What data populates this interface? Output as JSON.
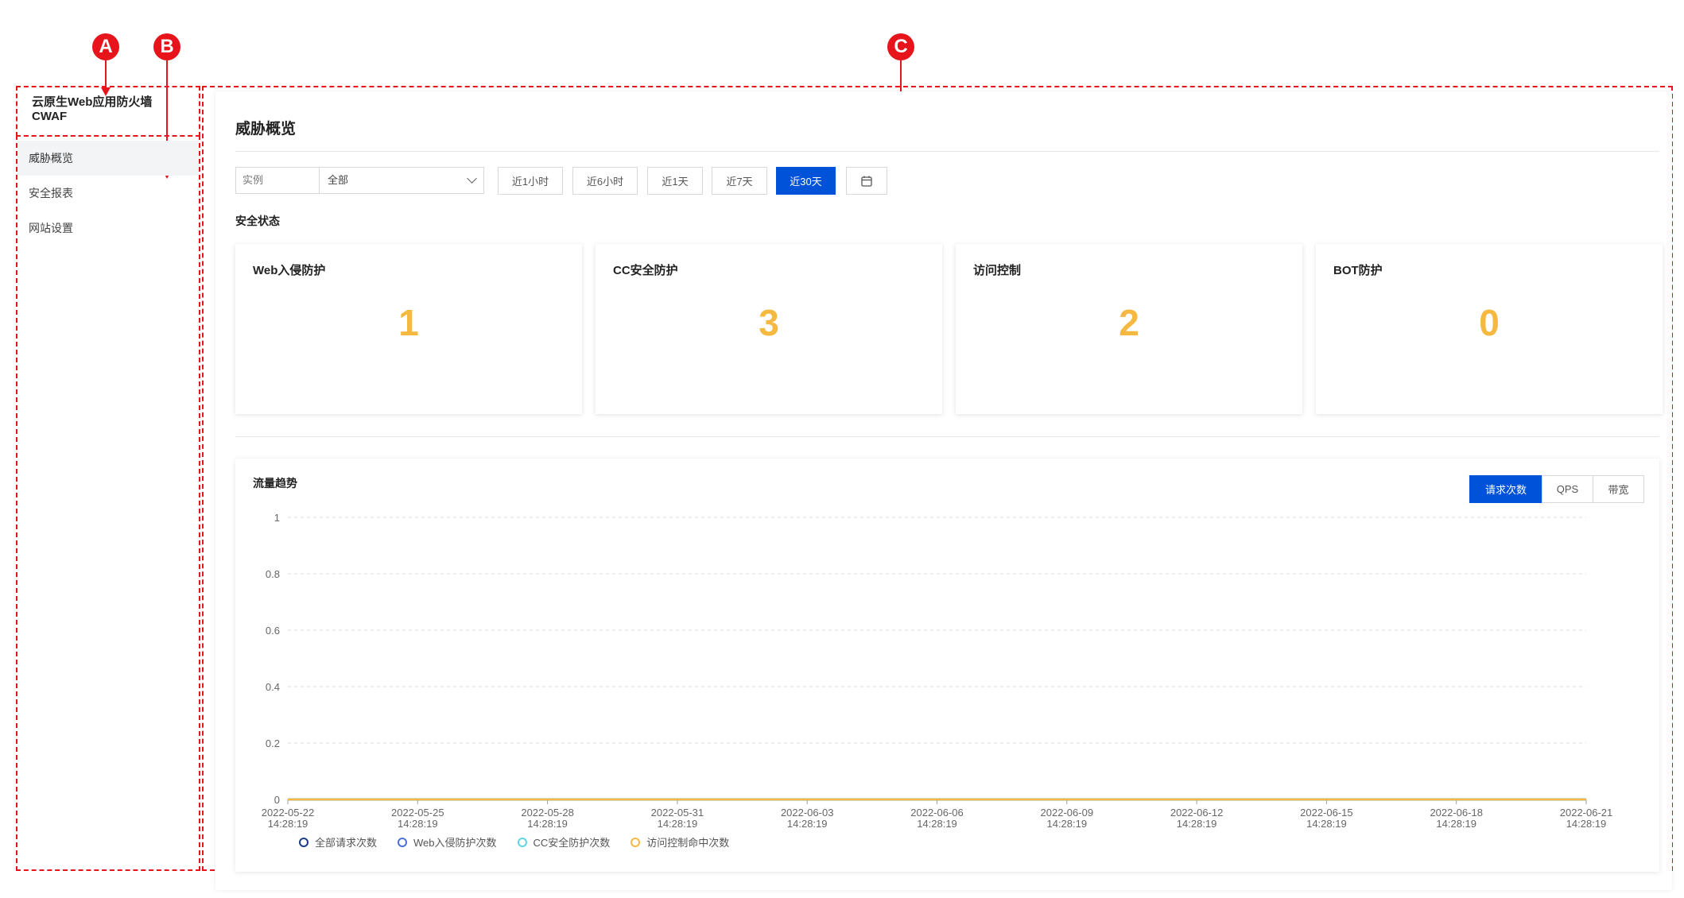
{
  "callouts": [
    "A",
    "B",
    "C"
  ],
  "sidebar": {
    "brand_line1": "云原生Web应用防火墙",
    "brand_line2": "CWAF",
    "items": [
      {
        "label": "威胁概览",
        "active": true
      },
      {
        "label": "安全报表",
        "active": false
      },
      {
        "label": "网站设置",
        "active": false
      }
    ]
  },
  "main": {
    "title": "威胁概览",
    "filter": {
      "instance_label": "实例",
      "instance_value": "全部",
      "time_buttons": [
        "近1小时",
        "近6小时",
        "近1天",
        "近7天",
        "近30天"
      ],
      "active_time": "近30天",
      "calendar_icon": "calendar-icon"
    },
    "security_status": {
      "title": "安全状态",
      "cards": [
        {
          "label": "Web入侵防护",
          "value": "1"
        },
        {
          "label": "CC安全防护",
          "value": "3"
        },
        {
          "label": "访问控制",
          "value": "2"
        },
        {
          "label": "BOT防护",
          "value": "0"
        }
      ],
      "value_color": "#f5b841"
    },
    "traffic": {
      "title": "流量趋势",
      "metric_tabs": [
        "请求次数",
        "QPS",
        "带宽"
      ],
      "active_metric": "请求次数"
    }
  },
  "accent_color": "#0052d9",
  "chart_data": {
    "type": "line",
    "title": "流量趋势",
    "ylim": [
      0,
      1
    ],
    "yticks": [
      "1",
      "0.8",
      "0.6",
      "0.4",
      "0.2",
      "0"
    ],
    "x_ticks": [
      {
        "date": "2022-05-22",
        "time": "14:28:19"
      },
      {
        "date": "2022-05-25",
        "time": "14:28:19"
      },
      {
        "date": "2022-05-28",
        "time": "14:28:19"
      },
      {
        "date": "2022-05-31",
        "time": "14:28:19"
      },
      {
        "date": "2022-06-03",
        "time": "14:28:19"
      },
      {
        "date": "2022-06-06",
        "time": "14:28:19"
      },
      {
        "date": "2022-06-09",
        "time": "14:28:19"
      },
      {
        "date": "2022-06-12",
        "time": "14:28:19"
      },
      {
        "date": "2022-06-15",
        "time": "14:28:19"
      },
      {
        "date": "2022-06-18",
        "time": "14:28:19"
      },
      {
        "date": "2022-06-21",
        "time": "14:28:19"
      }
    ],
    "series": [
      {
        "name": "全部请求次数",
        "color": "#1f3a8a",
        "values": [
          0,
          0,
          0,
          0,
          0,
          0,
          0,
          0,
          0,
          0,
          0
        ]
      },
      {
        "name": "Web入侵防护次数",
        "color": "#4d6fd8",
        "values": [
          0,
          0,
          0,
          0,
          0,
          0,
          0,
          0,
          0,
          0,
          0
        ]
      },
      {
        "name": "CC安全防护次数",
        "color": "#5fd3e0",
        "values": [
          0,
          0,
          0,
          0,
          0,
          0,
          0,
          0,
          0,
          0,
          0
        ]
      },
      {
        "name": "访问控制命中次数",
        "color": "#f5b841",
        "values": [
          0,
          0,
          0,
          0,
          0,
          0,
          0,
          0,
          0,
          0,
          0
        ]
      }
    ],
    "grid": true,
    "legend_position": "bottom-left"
  }
}
